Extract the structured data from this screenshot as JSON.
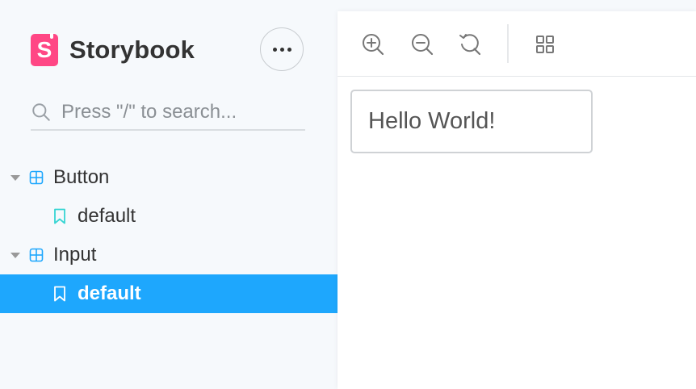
{
  "brand": {
    "name": "Storybook",
    "logo_letter": "S",
    "logo_color": "#ff4785"
  },
  "menu": {
    "icon": "ellipsis-icon"
  },
  "search": {
    "placeholder": "Press \"/\" to search...",
    "value": ""
  },
  "tree": {
    "components": [
      {
        "label": "Button",
        "stories": [
          {
            "label": "default",
            "selected": false
          }
        ]
      },
      {
        "label": "Input",
        "stories": [
          {
            "label": "default",
            "selected": true
          }
        ]
      }
    ]
  },
  "toolbar": {
    "tools": [
      "zoom-in-icon",
      "zoom-out-icon",
      "reset-zoom-icon",
      "grid-icon"
    ]
  },
  "preview": {
    "input_value": "Hello World!"
  },
  "colors": {
    "selection": "#1ea7fd",
    "component_icon": "#1ea7fd",
    "story_icon": "#37d5d3",
    "sidebar_bg": "#f6f9fc"
  }
}
